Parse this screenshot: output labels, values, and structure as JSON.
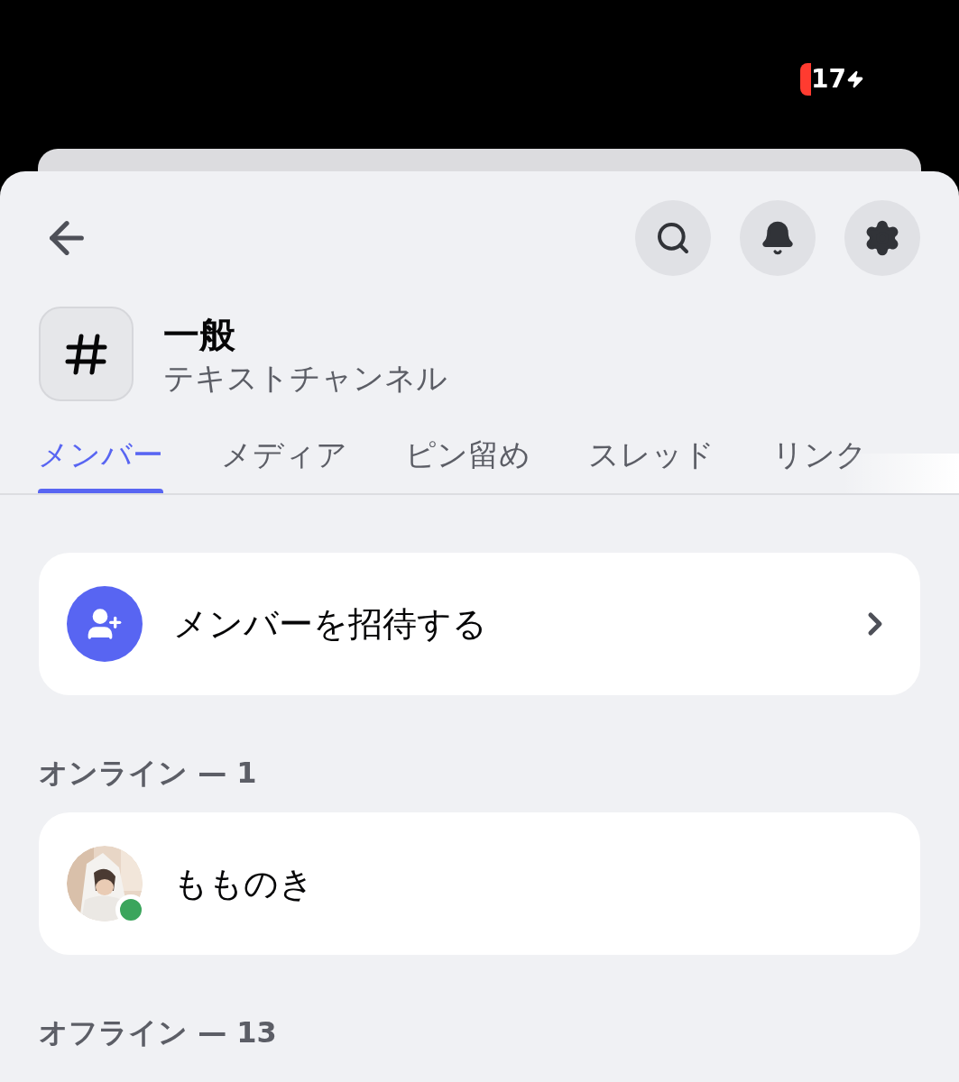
{
  "status_bar": {
    "battery": "17",
    "charging": true
  },
  "header": {
    "buttons": [
      {
        "kind": "search"
      },
      {
        "kind": "bell"
      },
      {
        "kind": "gear"
      }
    ]
  },
  "channel": {
    "name": "一般",
    "type": "テキストチャンネル"
  },
  "tabs": [
    {
      "label": "メンバー",
      "selected": true
    },
    {
      "label": "メディア",
      "selected": false
    },
    {
      "label": "ピン留め",
      "selected": false
    },
    {
      "label": "スレッド",
      "selected": false
    },
    {
      "label": "リンク",
      "selected": false
    }
  ],
  "invite": {
    "label": "メンバーを招待する"
  },
  "sections": [
    {
      "title": "オンライン — 1",
      "members": [
        {
          "name": "もものき",
          "online": true
        }
      ]
    },
    {
      "title": "オフライン — 13"
    }
  ]
}
